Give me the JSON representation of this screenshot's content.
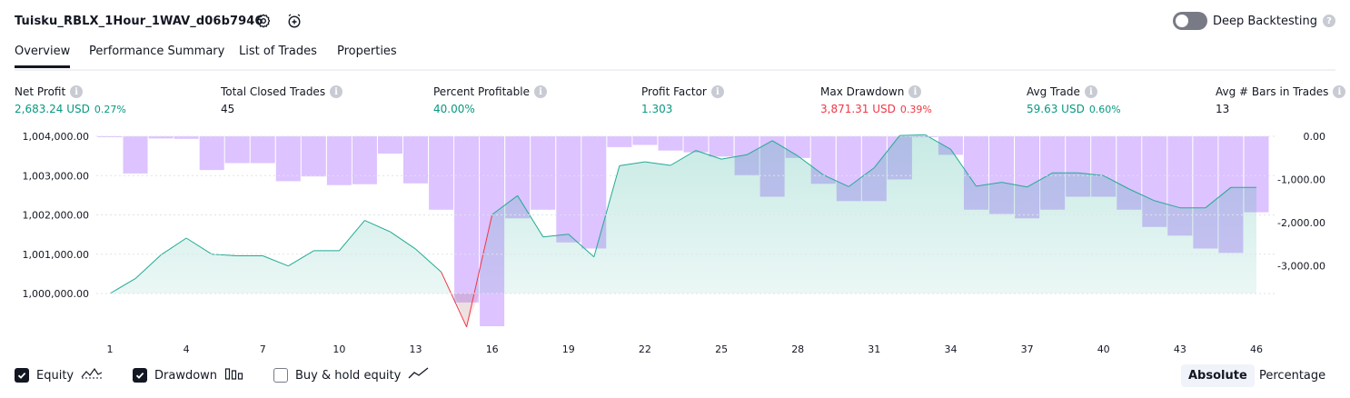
{
  "header": {
    "strategy_name": "Tuisku_RBLX_1Hour_1WAV_d06b7946",
    "settings_icon": "gear-icon",
    "add_alert_icon": "alarm-plus-icon",
    "deep_backtesting_label": "Deep Backtesting",
    "deep_backtesting_enabled": false,
    "help_icon": "question-icon"
  },
  "tabs": [
    {
      "label": "Overview",
      "active": true
    },
    {
      "label": "Performance Summary",
      "active": false
    },
    {
      "label": "List of Trades",
      "active": false
    },
    {
      "label": "Properties",
      "active": false
    }
  ],
  "metrics": [
    {
      "label": "Net Profit",
      "value": "2,683.24 USD",
      "pct": "0.27%",
      "color": "green"
    },
    {
      "label": "Total Closed Trades",
      "value": "45",
      "pct": "",
      "color": "dark"
    },
    {
      "label": "Percent Profitable",
      "value": "40.00%",
      "pct": "",
      "color": "green"
    },
    {
      "label": "Profit Factor",
      "value": "1.303",
      "pct": "",
      "color": "green"
    },
    {
      "label": "Max Drawdown",
      "value": "3,871.31 USD",
      "pct": "0.39%",
      "color": "red"
    },
    {
      "label": "Avg Trade",
      "value": "59.63 USD",
      "pct": "0.60%",
      "color": "green"
    },
    {
      "label": "Avg # Bars in Trades",
      "value": "13",
      "pct": "",
      "color": "dark"
    }
  ],
  "chart_data": {
    "type": "area",
    "left_axis": {
      "ticks": [
        "1,004,000.00",
        "1,003,000.00",
        "1,002,000.00",
        "1,001,000.00",
        "1,000,000.00"
      ],
      "range": [
        999200,
        1004000
      ]
    },
    "right_axis": {
      "ticks": [
        "0.00",
        "-1,000.00",
        "-2,000.00",
        "-3,000.00"
      ],
      "range": [
        -3871.31,
        0
      ]
    },
    "x_ticks": [
      "1",
      "4",
      "7",
      "10",
      "13",
      "16",
      "19",
      "22",
      "25",
      "28",
      "31",
      "34",
      "37",
      "40",
      "43",
      "46"
    ],
    "series": [
      {
        "name": "Equity",
        "color": "#22ab94",
        "x": [
          1,
          2,
          3,
          4,
          5,
          6,
          7,
          8,
          9,
          10,
          11,
          12,
          13,
          14,
          15,
          16,
          17,
          18,
          19,
          20,
          21,
          22,
          23,
          24,
          25,
          26,
          27,
          28,
          29,
          30,
          31,
          32,
          33,
          34,
          35,
          36,
          37,
          38,
          39,
          40,
          41,
          42,
          43,
          44,
          45,
          46
        ],
        "values": [
          1000000,
          1000380,
          1000980,
          1001410,
          1001000,
          1000960,
          1000960,
          1000700,
          1001090,
          1001090,
          1001860,
          1001570,
          1001130,
          1000550,
          999150,
          1002010,
          1002490,
          1001440,
          1001510,
          1000930,
          1003250,
          1003350,
          1003260,
          1003640,
          1003420,
          1003530,
          1003890,
          1003500,
          1003020,
          1002720,
          1003200,
          1004020,
          1004040,
          1003670,
          1002730,
          1002830,
          1002710,
          1003070,
          1003070,
          1003000,
          1002660,
          1002360,
          1002180,
          1002180,
          1002700,
          1002700
        ]
      },
      {
        "name": "Drawdown",
        "color": "#ce93d8",
        "x": [
          1,
          2,
          3,
          4,
          5,
          6,
          7,
          8,
          9,
          10,
          11,
          12,
          13,
          14,
          15,
          16,
          17,
          18,
          19,
          20,
          21,
          22,
          23,
          24,
          25,
          26,
          27,
          28,
          29,
          30,
          31,
          32,
          33,
          34,
          35,
          36,
          37,
          38,
          39,
          40,
          41,
          42,
          43,
          44,
          45,
          46
        ],
        "values": [
          0,
          -860,
          -50,
          -60,
          -780,
          -620,
          -620,
          -1040,
          -930,
          -1130,
          -1110,
          -400,
          -1090,
          -1700,
          -3850,
          -4400,
          -1900,
          -1700,
          -2460,
          -2600,
          -250,
          -200,
          -330,
          -370,
          -470,
          -900,
          -1400,
          -500,
          -1100,
          -1500,
          -1500,
          -1000,
          0,
          -430,
          -1700,
          -1800,
          -1900,
          -1700,
          -1400,
          -1400,
          -1700,
          -2100,
          -2300,
          -2600,
          -2700,
          -1760
        ]
      }
    ],
    "legend": [
      {
        "label": "Equity",
        "checked": true,
        "icon": "equity-line-icon"
      },
      {
        "label": "Drawdown",
        "checked": true,
        "icon": "drawdown-bars-icon"
      },
      {
        "label": "Buy & hold equity",
        "checked": false,
        "icon": "buy-hold-line-icon"
      }
    ],
    "modes": [
      {
        "label": "Absolute",
        "active": true
      },
      {
        "label": "Percentage",
        "active": false
      }
    ]
  }
}
